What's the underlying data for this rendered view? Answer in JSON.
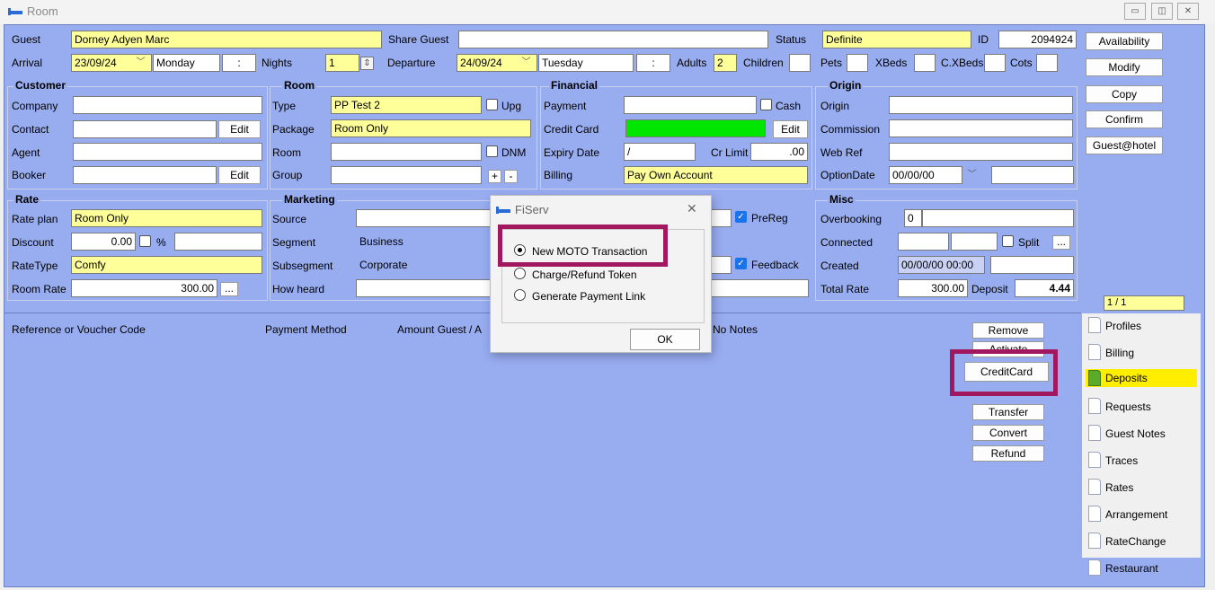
{
  "window": {
    "title": "Room",
    "min": "▭",
    "max": "◫",
    "close": "✕"
  },
  "row1": {
    "guest_label": "Guest",
    "guest": "Dorney Adyen Marc",
    "share_label": "Share Guest",
    "share": "",
    "status_label": "Status",
    "status": "Definite",
    "id_label": "ID",
    "id": "2094924"
  },
  "row2": {
    "arrival_label": "Arrival",
    "arrival": "23/09/24",
    "arrival_day": "Monday",
    "arrival_time": ":",
    "nights_label": "Nights",
    "nights": "1",
    "departure_label": "Departure",
    "departure": "24/09/24",
    "departure_day": "Tuesday",
    "departure_time": ":",
    "adults_label": "Adults",
    "adults": "2",
    "children_label": "Children",
    "pets_label": "Pets",
    "xbeds_label": "XBeds",
    "cxbeds_label": "C.XBeds",
    "cots_label": "Cots"
  },
  "side_buttons": [
    "Availability",
    "Modify",
    "Copy",
    "Confirm",
    "Guest@hotel"
  ],
  "customer": {
    "title": "Customer",
    "company": "Company",
    "contact": "Contact",
    "agent": "Agent",
    "booker": "Booker",
    "edit": "Edit"
  },
  "room": {
    "title": "Room",
    "type_label": "Type",
    "type": "PP Test 2",
    "upg": "Upg",
    "package_label": "Package",
    "package": "Room Only",
    "room_label": "Room",
    "dnm": "DNM",
    "group_label": "Group",
    "plus": "+",
    "minus": "-"
  },
  "financial": {
    "title": "Financial",
    "payment_label": "Payment",
    "cash": "Cash",
    "cc_label": "Credit Card",
    "edit": "Edit",
    "expiry_label": "Expiry Date",
    "expiry": "/",
    "crlimit_label": "Cr Limit",
    "crlimit": ".00",
    "billing_label": "Billing",
    "billing": "Pay Own Account",
    "prereg": "PreReg",
    "feedback": "Feedback"
  },
  "origin": {
    "title": "Origin",
    "origin_label": "Origin",
    "commission_label": "Commission",
    "webref_label": "Web Ref",
    "optiondate_label": "OptionDate",
    "optiondate": "00/00/00"
  },
  "rate": {
    "title": "Rate",
    "plan_label": "Rate plan",
    "plan": "Room Only",
    "discount_label": "Discount",
    "discount": "0.00",
    "pct": "%",
    "ratetype_label": "RateType",
    "ratetype": "Comfy",
    "roomrate_label": "Room Rate",
    "roomrate": "300.00",
    "dots": "..."
  },
  "marketing": {
    "title": "Marketing",
    "source_label": "Source",
    "segment_label": "Segment",
    "segment": "Business",
    "subsegment_label": "Subsegment",
    "subsegment": "Corporate",
    "howheard_label": "How heard"
  },
  "misc": {
    "title": "Misc",
    "overbooking_label": "Overbooking",
    "overbooking": "0",
    "connected_label": "Connected",
    "split": "Split",
    "dots": "...",
    "created_label": "Created",
    "created": "00/00/00 00:00",
    "totalrate_label": "Total Rate",
    "totalrate": "300.00",
    "deposit_label": "Deposit",
    "deposit": "4.44",
    "page": "1 / 1"
  },
  "deposits": {
    "col1": "Reference or Voucher Code",
    "col2": "Payment Method",
    "col3": "Amount Guest / A",
    "col4": "No Notes",
    "buttons": [
      "Remove",
      "Activate",
      "CreditCard",
      "Transfer",
      "Convert",
      "Refund"
    ]
  },
  "tabs": [
    "Profiles",
    "Billing",
    "Deposits",
    "Requests",
    "Guest Notes",
    "Traces",
    "Rates",
    "Arrangement",
    "RateChange",
    "Restaurant"
  ],
  "dialog": {
    "title": "FiServ",
    "close": "✕",
    "options": [
      "New MOTO Transaction",
      "Charge/Refund Token",
      "Generate Payment Link"
    ],
    "ok": "OK"
  },
  "colors": {
    "panel": "#98acf0",
    "highlight": "#a1185f",
    "yellow": "#ffff9a",
    "green": "#00e600"
  }
}
